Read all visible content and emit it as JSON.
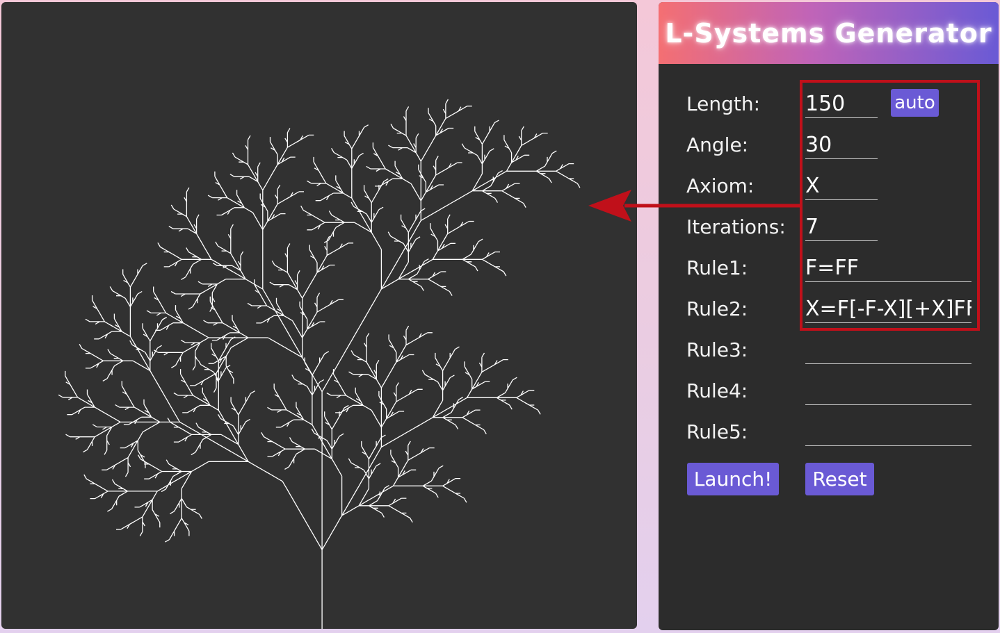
{
  "app": {
    "title": "L-Systems Generator"
  },
  "form": {
    "length": {
      "label": "Length:",
      "value": "150"
    },
    "auto_label": "auto",
    "angle": {
      "label": "Angle:",
      "value": "30"
    },
    "axiom": {
      "label": "Axiom:",
      "value": "X"
    },
    "iterations": {
      "label": "Iterations:",
      "value": "7"
    },
    "rule1": {
      "label": "Rule1:",
      "value": "F=FF"
    },
    "rule2": {
      "label": "Rule2:",
      "value": "X=F[-F-X][+X]FF["
    },
    "rule3": {
      "label": "Rule3:",
      "value": ""
    },
    "rule4": {
      "label": "Rule4:",
      "value": ""
    },
    "rule5": {
      "label": "Rule5:",
      "value": ""
    }
  },
  "buttons": {
    "launch": "Launch!",
    "reset": "Reset"
  },
  "colors": {
    "canvas_bg": "#313131",
    "panel_bg": "#2c2c2c",
    "accent": "#6a5ad5",
    "annotation": "#c0101a",
    "tree": "#ffffff"
  },
  "icons": {
    "arrow": "annotation-arrow-left"
  }
}
